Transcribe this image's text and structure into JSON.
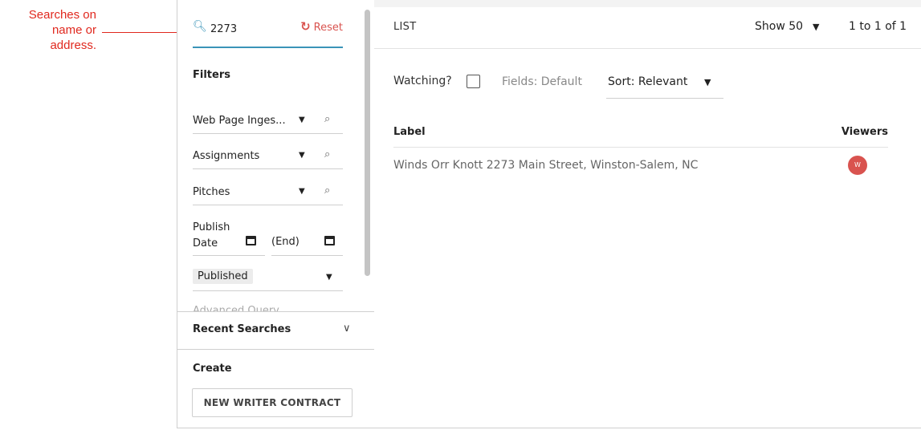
{
  "annotation": {
    "lines": [
      "Searches on",
      "name or",
      "address."
    ]
  },
  "sidebar": {
    "search": {
      "value": "2273",
      "reset_label": "Reset",
      "icon": "search-icon"
    },
    "filters_title": "Filters",
    "filters": [
      {
        "label": "Web Page Inges..."
      },
      {
        "label": "Assignments"
      },
      {
        "label": "Pitches"
      }
    ],
    "date": {
      "start_label_line1": "Publish",
      "start_label_line2": "Date",
      "end_label": "(End)"
    },
    "status_chip": "Published",
    "cut_off_item": "Advanced Query",
    "recent_searches": "Recent Searches",
    "create_title": "Create",
    "create_button": "NEW WRITER CONTRACT"
  },
  "main": {
    "title": "LIST",
    "show_label": "Show 50",
    "pagination": "1 to 1 of 1",
    "watching_label": "Watching?",
    "watching_checked": false,
    "fields_label": "Fields: Default",
    "sort_label": "Sort: Relevant",
    "table": {
      "headers": {
        "label": "Label",
        "viewers": "Viewers"
      },
      "rows": [
        {
          "label": "Winds Orr Knott 2273 Main Street, Winston-Salem, NC",
          "viewer_initial": "W"
        }
      ]
    }
  },
  "colors": {
    "accent": "#3a94b8",
    "reset": "#d9534f",
    "annotation": "#e0281e",
    "avatar": "#d9534f"
  }
}
